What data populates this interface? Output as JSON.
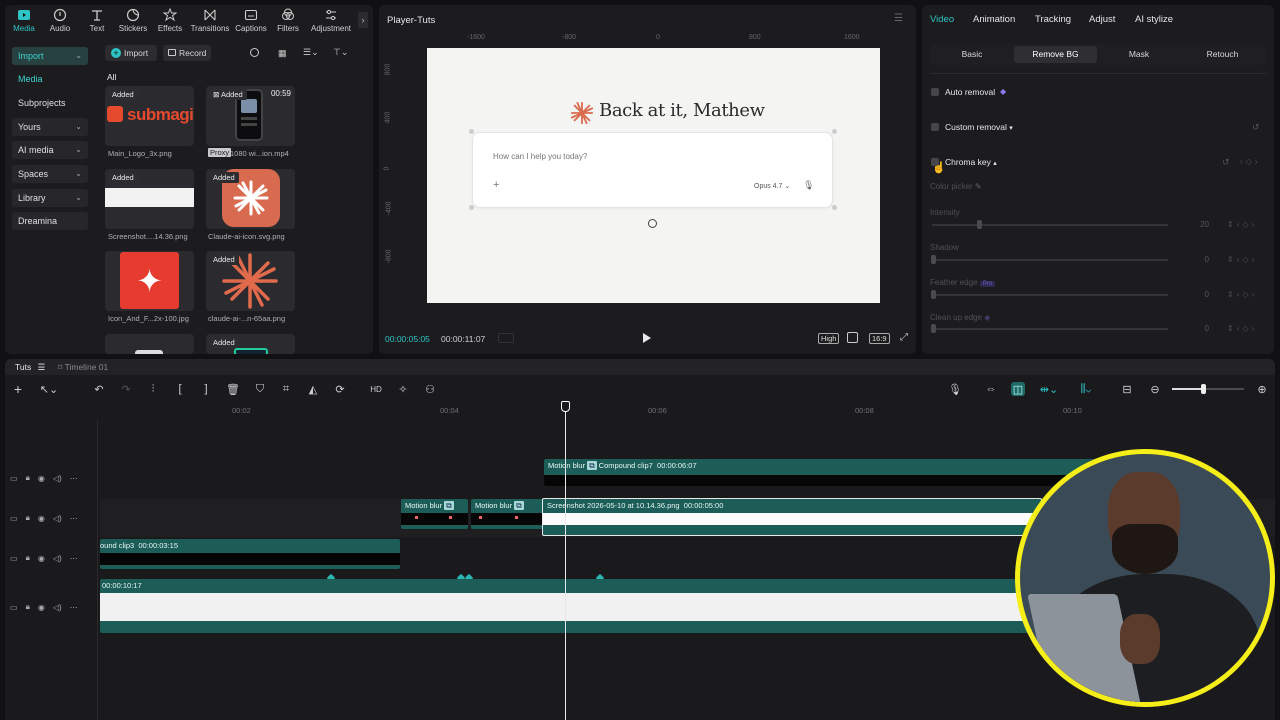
{
  "toolbar": {
    "tabs": [
      {
        "label": "Media",
        "icon": "media-icon"
      },
      {
        "label": "Audio",
        "icon": "audio-icon"
      },
      {
        "label": "Text",
        "icon": "text-icon"
      },
      {
        "label": "Stickers",
        "icon": "stickers-icon"
      },
      {
        "label": "Effects",
        "icon": "effects-icon"
      },
      {
        "label": "Transitions",
        "icon": "transitions-icon"
      },
      {
        "label": "Captions",
        "icon": "captions-icon"
      },
      {
        "label": "Filters",
        "icon": "filters-icon"
      },
      {
        "label": "Adjustment",
        "icon": "adjustment-icon"
      }
    ]
  },
  "sidebar": {
    "import": "Import",
    "media": "Media",
    "subprojects": "Subprojects",
    "yours": "Yours",
    "ai_media": "AI media",
    "spaces": "Spaces",
    "library": "Library",
    "dreamina": "Dreamina"
  },
  "media": {
    "import_btn": "Import",
    "record_btn": "Record",
    "filter_all": "All",
    "added": "Added",
    "proxy": "Proxy",
    "duration": "00:59",
    "submagic_text": "submagic",
    "items": [
      "Main_Logo_3x.png",
      "1080 wi...ion.mp4",
      "Screenshot....14.36.png",
      "Claude-ai-icon.svg.png",
      "Icon_And_F...2x-100.jpg",
      "claude-ai-...n-65aa.png"
    ]
  },
  "player": {
    "title": "Player-Tuts",
    "ruler": [
      "-1600",
      "-800",
      "0",
      "800",
      "1600"
    ],
    "vruler": [
      "800",
      "400",
      "0",
      "-400",
      "-800"
    ],
    "heading": "Back at it, Mathew",
    "prompt_placeholder": "How can I help you today?",
    "model": "Opus 4.7",
    "current_time": "00:00:05:05",
    "total_time": "00:00:11:07",
    "quality": "High",
    "ratio": "16:9"
  },
  "inspector": {
    "tabs": [
      "Video",
      "Animation",
      "Tracking",
      "Adjust",
      "AI stylize"
    ],
    "subtabs": [
      "Basic",
      "Remove BG",
      "Mask",
      "Retouch"
    ],
    "auto_removal": "Auto removal",
    "custom_removal": "Custom removal",
    "chroma_key": "Chroma key",
    "color_picker": "Color picker",
    "intensity": "Intensity",
    "intensity_value": "20",
    "shadow": "Shadow",
    "shadow_value": "0",
    "feather_edge": "Feather edge",
    "feather_value": "0",
    "feather_badge": "Pro",
    "cleanup_edge": "Clean up edge",
    "cleanup_value": "0",
    "colors": {
      "accent": "#2ec4c6",
      "clip": "#1d5d58"
    }
  },
  "timeline": {
    "project": "Tuts",
    "tab": "Timeline 01",
    "ruler": [
      "00:02",
      "00:04",
      "00:06",
      "00:08",
      "00:10"
    ],
    "clips": {
      "compound7": "Compound clip7",
      "compound7_dur": "00:00:06:07",
      "motion_blur": "Motion blur",
      "screenshot": "Screenshot 2026-05-10 at 10.14.36.png",
      "screenshot_dur": "00:00:05:00",
      "compound3": "ound clip3",
      "compound3_dur": "00:00:03:15",
      "main_dur": "00:00:10:17"
    },
    "zoom_level": 0.43
  }
}
